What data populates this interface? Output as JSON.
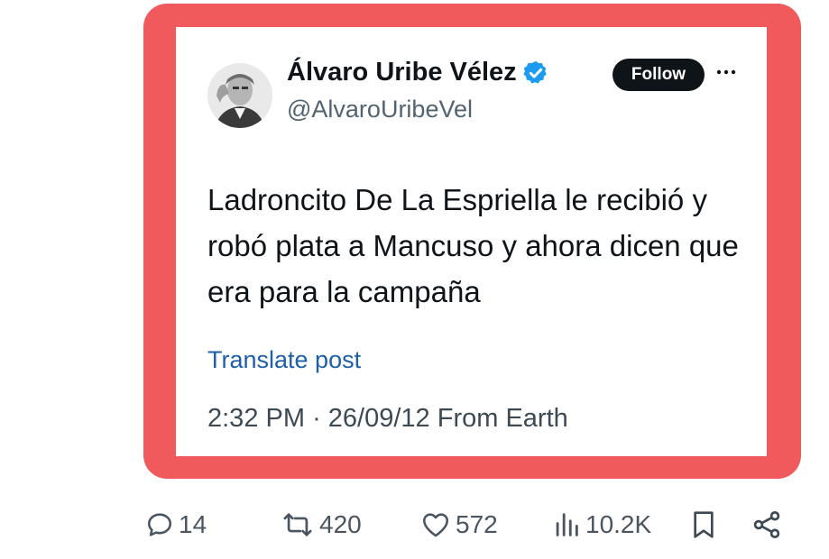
{
  "post": {
    "author": {
      "display_name": "Álvaro Uribe Vélez",
      "handle": "@AlvaroUribeVel",
      "verified": true
    },
    "follow_label": "Follow",
    "text": "Ladroncito De La Espriella le recibió y robó plata a Mancuso y ahora dicen que era para la campaña",
    "translate_label": "Translate post",
    "time": "2:32 PM",
    "separator": "·",
    "date": "26/09/12",
    "source": "From Earth"
  },
  "actions": {
    "replies": "14",
    "reposts": "420",
    "likes": "572",
    "views": "10.2K"
  },
  "colors": {
    "frame": "#f05a5c",
    "verified": "#1d9bf0",
    "link": "#1d5fa8",
    "text": "#0f1419",
    "muted": "#536471"
  },
  "icons": {
    "verified": "verified-badge-icon",
    "more": "more-dots-icon",
    "reply": "reply-bubble-icon",
    "repost": "repost-arrows-icon",
    "like": "heart-icon",
    "views": "bar-chart-icon",
    "bookmark": "bookmark-icon",
    "share": "share-icon"
  }
}
